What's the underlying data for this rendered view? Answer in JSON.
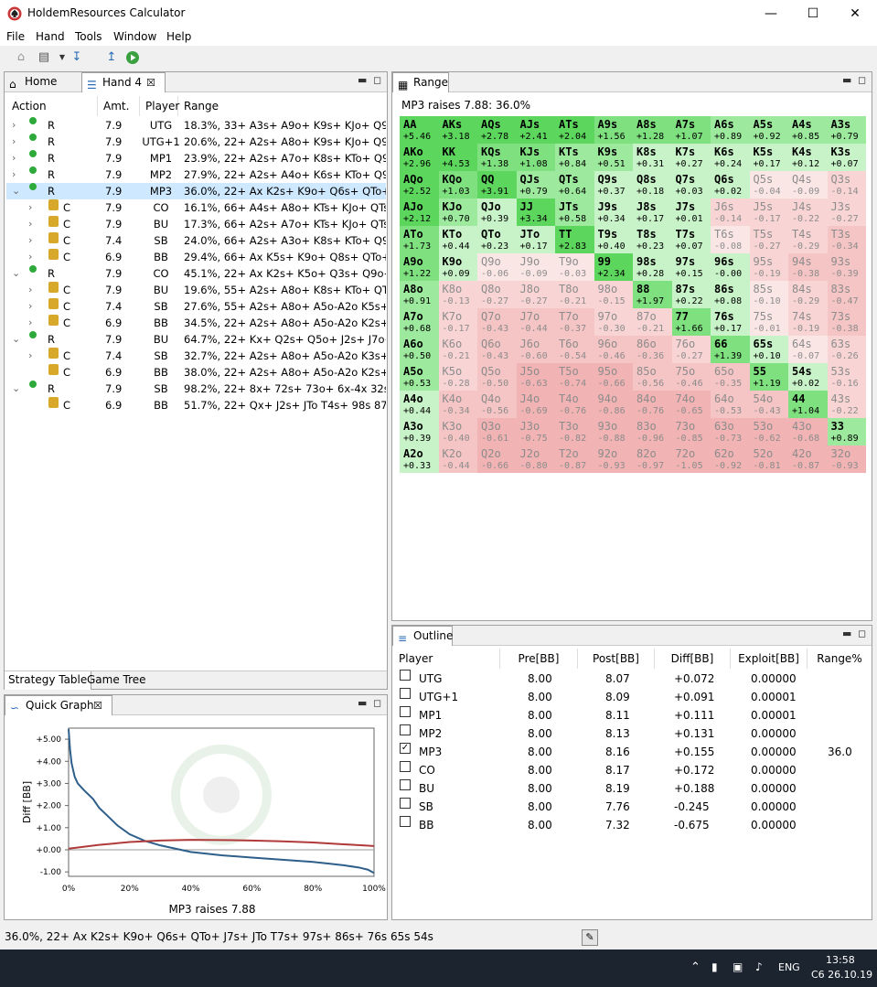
{
  "window": {
    "title": "HoldemResources Calculator"
  },
  "menu": [
    "File",
    "Hand",
    "Tools",
    "Window",
    "Help"
  ],
  "tabs": {
    "home": "Home",
    "hand": "Hand 4",
    "range": "Range",
    "outline": "Outline",
    "quick_graph": "Quick Graph",
    "strategy_table": "Strategy Table",
    "game_tree": "Game Tree"
  },
  "strategy": {
    "headers": [
      "Action",
      "Amt.",
      "Player",
      "Range"
    ],
    "rows": [
      {
        "action": "R",
        "amt": "7.9",
        "player": "UTG",
        "range": "18.3%, 33+ A3s+ A9o+ K9s+ KJo+ Q9s+ J9",
        "indent": 0,
        "open": false,
        "lock": false
      },
      {
        "action": "R",
        "amt": "7.9",
        "player": "UTG+1",
        "range": "20.6%, 22+ A2s+ A8o+ K9s+ KJo+ Q9s+ J9",
        "indent": 0,
        "open": false,
        "lock": false
      },
      {
        "action": "R",
        "amt": "7.9",
        "player": "MP1",
        "range": "23.9%, 22+ A2s+ A7o+ K8s+ KTo+ Q9s+ Q",
        "indent": 0,
        "open": false,
        "lock": false
      },
      {
        "action": "R",
        "amt": "7.9",
        "player": "MP2",
        "range": "27.9%, 22+ A2s+ A4o+ K6s+ KTo+ Q9s+ Q",
        "indent": 0,
        "open": false,
        "lock": false
      },
      {
        "action": "R",
        "amt": "7.9",
        "player": "MP3",
        "range": "36.0%, 22+ Ax K2s+ K9o+ Q6s+ QTo+ J7s+",
        "indent": 0,
        "open": true,
        "lock": false,
        "sel": true
      },
      {
        "action": "C",
        "amt": "7.9",
        "player": "CO",
        "range": "16.1%, 66+ A4s+ A8o+ KTs+ KJo+ QTs+ JT",
        "indent": 1,
        "open": false,
        "lock": true
      },
      {
        "action": "C",
        "amt": "7.9",
        "player": "BU",
        "range": "17.3%, 66+ A2s+ A7o+ KTs+ KJo+ QTs+",
        "indent": 1,
        "open": false,
        "lock": true
      },
      {
        "action": "C",
        "amt": "7.4",
        "player": "SB",
        "range": "24.0%, 66+ A2s+ A3o+ K8s+ KTo+ Q9s+ Q",
        "indent": 1,
        "open": false,
        "lock": true
      },
      {
        "action": "C",
        "amt": "6.9",
        "player": "BB",
        "range": "29.4%, 66+ Ax K5s+ K9o+ Q8s+ QTo+ J9s+",
        "indent": 1,
        "open": false,
        "lock": true
      },
      {
        "action": "R",
        "amt": "7.9",
        "player": "CO",
        "range": "45.1%, 22+ Ax K2s+ K5o+ Q3s+ Q9o+ J6s+",
        "indent": 0,
        "open": true,
        "lock": false
      },
      {
        "action": "C",
        "amt": "7.9",
        "player": "BU",
        "range": "19.6%, 55+ A2s+ A8o+ K8s+ KTo+ QTs+ Q",
        "indent": 1,
        "open": false,
        "lock": true
      },
      {
        "action": "C",
        "amt": "7.4",
        "player": "SB",
        "range": "27.6%, 55+ A2s+ A8o+ A5o-A2o K5s+ K9o",
        "indent": 1,
        "open": false,
        "lock": true
      },
      {
        "action": "C",
        "amt": "6.9",
        "player": "BB",
        "range": "34.5%, 22+ A2s+ A8o+ A5o-A2o K2s+ K8o",
        "indent": 1,
        "open": false,
        "lock": true
      },
      {
        "action": "R",
        "amt": "7.9",
        "player": "BU",
        "range": "64.7%, 22+ Kx+ Q2s+ Q5o+ J2s+ J7o+ T3s-",
        "indent": 0,
        "open": true,
        "lock": false
      },
      {
        "action": "C",
        "amt": "7.4",
        "player": "SB",
        "range": "32.7%, 22+ A2s+ A8o+ A5o-A2o K3s+ K8o",
        "indent": 1,
        "open": false,
        "lock": true
      },
      {
        "action": "C",
        "amt": "6.9",
        "player": "BB",
        "range": "38.0%, 22+ A2s+ A8o+ A5o-A2o K2s+ K8o",
        "indent": 1,
        "open": false,
        "lock": true,
        "noarrow": true
      },
      {
        "action": "R",
        "amt": "7.9",
        "player": "SB",
        "range": "98.2%, 22+ 8x+ 72s+ 73o+ 6x-4x 32s",
        "indent": 0,
        "open": true,
        "lock": false
      },
      {
        "action": "C",
        "amt": "6.9",
        "player": "BB",
        "range": "51.7%, 22+ Qx+ J2s+ JTo T4s+ 98s 87s",
        "indent": 1,
        "open": false,
        "lock": true,
        "noarrow": true
      }
    ]
  },
  "range_panel": {
    "caption": "MP3 raises 7.88: 36.0%",
    "hands": [
      [
        "AA",
        "AKs",
        "AQs",
        "AJs",
        "ATs",
        "A9s",
        "A8s",
        "A7s",
        "A6s",
        "A5s",
        "A4s",
        "A3s"
      ],
      [
        "AKo",
        "KK",
        "KQs",
        "KJs",
        "KTs",
        "K9s",
        "K8s",
        "K7s",
        "K6s",
        "K5s",
        "K4s",
        "K3s"
      ],
      [
        "AQo",
        "KQo",
        "QQ",
        "QJs",
        "QTs",
        "Q9s",
        "Q8s",
        "Q7s",
        "Q6s",
        "Q5s",
        "Q4s",
        "Q3s"
      ],
      [
        "AJo",
        "KJo",
        "QJo",
        "JJ",
        "JTs",
        "J9s",
        "J8s",
        "J7s",
        "J6s",
        "J5s",
        "J4s",
        "J3s"
      ],
      [
        "ATo",
        "KTo",
        "QTo",
        "JTo",
        "TT",
        "T9s",
        "T8s",
        "T7s",
        "T6s",
        "T5s",
        "T4s",
        "T3s"
      ],
      [
        "A9o",
        "K9o",
        "Q9o",
        "J9o",
        "T9o",
        "99",
        "98s",
        "97s",
        "96s",
        "95s",
        "94s",
        "93s"
      ],
      [
        "A8o",
        "K8o",
        "Q8o",
        "J8o",
        "T8o",
        "98o",
        "88",
        "87s",
        "86s",
        "85s",
        "84s",
        "83s"
      ],
      [
        "A7o",
        "K7o",
        "Q7o",
        "J7o",
        "T7o",
        "97o",
        "87o",
        "77",
        "76s",
        "75s",
        "74s",
        "73s"
      ],
      [
        "A6o",
        "K6o",
        "Q6o",
        "J6o",
        "T6o",
        "96o",
        "86o",
        "76o",
        "66",
        "65s",
        "64s",
        "63s"
      ],
      [
        "A5o",
        "K5o",
        "Q5o",
        "J5o",
        "T5o",
        "95o",
        "85o",
        "75o",
        "65o",
        "55",
        "54s",
        "53s"
      ],
      [
        "A4o",
        "K4o",
        "Q4o",
        "J4o",
        "T4o",
        "94o",
        "84o",
        "74o",
        "64o",
        "54o",
        "44",
        "43s"
      ],
      [
        "A3o",
        "K3o",
        "Q3o",
        "J3o",
        "T3o",
        "93o",
        "83o",
        "73o",
        "63o",
        "53o",
        "43o",
        "33"
      ],
      [
        "A2o",
        "K2o",
        "Q2o",
        "J2o",
        "T2o",
        "92o",
        "82o",
        "72o",
        "62o",
        "52o",
        "42o",
        "32o"
      ]
    ],
    "values": [
      [
        "+5.46",
        "+3.18",
        "+2.78",
        "+2.41",
        "+2.04",
        "+1.56",
        "+1.28",
        "+1.07",
        "+0.89",
        "+0.92",
        "+0.85",
        "+0.79"
      ],
      [
        "+2.96",
        "+4.53",
        "+1.38",
        "+1.08",
        "+0.84",
        "+0.51",
        "+0.31",
        "+0.27",
        "+0.24",
        "+0.17",
        "+0.12",
        "+0.07"
      ],
      [
        "+2.52",
        "+1.03",
        "+3.91",
        "+0.79",
        "+0.64",
        "+0.37",
        "+0.18",
        "+0.03",
        "+0.02",
        "-0.04",
        "-0.09",
        "-0.14"
      ],
      [
        "+2.12",
        "+0.70",
        "+0.39",
        "+3.34",
        "+0.58",
        "+0.34",
        "+0.17",
        "+0.01",
        "-0.14",
        "-0.17",
        "-0.22",
        "-0.27"
      ],
      [
        "+1.73",
        "+0.44",
        "+0.23",
        "+0.17",
        "+2.83",
        "+0.40",
        "+0.23",
        "+0.07",
        "-0.08",
        "-0.27",
        "-0.29",
        "-0.34"
      ],
      [
        "+1.22",
        "+0.09",
        "-0.06",
        "-0.09",
        "-0.03",
        "+2.34",
        "+0.28",
        "+0.15",
        "-0.00",
        "-0.19",
        "-0.38",
        "-0.39"
      ],
      [
        "+0.91",
        "-0.13",
        "-0.27",
        "-0.27",
        "-0.21",
        "-0.15",
        "+1.97",
        "+0.22",
        "+0.08",
        "-0.10",
        "-0.29",
        "-0.47"
      ],
      [
        "+0.68",
        "-0.17",
        "-0.43",
        "-0.44",
        "-0.37",
        "-0.30",
        "-0.21",
        "+1.66",
        "+0.17",
        "-0.01",
        "-0.19",
        "-0.38"
      ],
      [
        "+0.50",
        "-0.21",
        "-0.43",
        "-0.60",
        "-0.54",
        "-0.46",
        "-0.36",
        "-0.27",
        "+1.39",
        "+0.10",
        "-0.07",
        "-0.26"
      ],
      [
        "+0.53",
        "-0.28",
        "-0.50",
        "-0.63",
        "-0.74",
        "-0.66",
        "-0.56",
        "-0.46",
        "-0.35",
        "+1.19",
        "+0.02",
        "-0.16"
      ],
      [
        "+0.44",
        "-0.34",
        "-0.56",
        "-0.69",
        "-0.76",
        "-0.86",
        "-0.76",
        "-0.65",
        "-0.53",
        "-0.43",
        "+1.04",
        "-0.22"
      ],
      [
        "+0.39",
        "-0.40",
        "-0.61",
        "-0.75",
        "-0.82",
        "-0.88",
        "-0.96",
        "-0.85",
        "-0.73",
        "-0.62",
        "-0.68",
        "+0.89"
      ],
      [
        "+0.33",
        "-0.44",
        "-0.66",
        "-0.80",
        "-0.87",
        "-0.93",
        "-0.97",
        "-1.05",
        "-0.92",
        "-0.81",
        "-0.87",
        "-0.93"
      ]
    ]
  },
  "outline": {
    "headers": [
      "Player",
      "Pre[BB]",
      "Post[BB]",
      "Diff[BB]",
      "Exploit[BB]",
      "Range%"
    ],
    "rows": [
      {
        "player": "UTG",
        "pre": "8.00",
        "post": "8.07",
        "diff": "+0.072",
        "exploit": "0.00000",
        "range": "",
        "checked": false
      },
      {
        "player": "UTG+1",
        "pre": "8.00",
        "post": "8.09",
        "diff": "+0.091",
        "exploit": "0.00001",
        "range": "",
        "checked": false
      },
      {
        "player": "MP1",
        "pre": "8.00",
        "post": "8.11",
        "diff": "+0.111",
        "exploit": "0.00001",
        "range": "",
        "checked": false
      },
      {
        "player": "MP2",
        "pre": "8.00",
        "post": "8.13",
        "diff": "+0.131",
        "exploit": "0.00000",
        "range": "",
        "checked": false
      },
      {
        "player": "MP3",
        "pre": "8.00",
        "post": "8.16",
        "diff": "+0.155",
        "exploit": "0.00000",
        "range": "36.0",
        "checked": true
      },
      {
        "player": "CO",
        "pre": "8.00",
        "post": "8.17",
        "diff": "+0.172",
        "exploit": "0.00000",
        "range": "",
        "checked": false
      },
      {
        "player": "BU",
        "pre": "8.00",
        "post": "8.19",
        "diff": "+0.188",
        "exploit": "0.00000",
        "range": "",
        "checked": false
      },
      {
        "player": "SB",
        "pre": "8.00",
        "post": "7.76",
        "diff": "-0.245",
        "exploit": "0.00000",
        "range": "",
        "checked": false
      },
      {
        "player": "BB",
        "pre": "8.00",
        "post": "7.32",
        "diff": "-0.675",
        "exploit": "0.00000",
        "range": "",
        "checked": false
      }
    ]
  },
  "chart_data": {
    "type": "line",
    "xlabel": "MP3 raises 7.88",
    "ylabel": "Diff [BB]",
    "x_ticks": [
      "0%",
      "20%",
      "40%",
      "60%",
      "80%",
      "100%"
    ],
    "y_ticks": [
      "+5.00",
      "+4.00",
      "+3.00",
      "+2.00",
      "+1.00",
      "+0.00",
      "-1.00"
    ],
    "xlim": [
      0,
      100
    ],
    "ylim": [
      -1.2,
      5.5
    ],
    "series": [
      {
        "color": "#2e5f8a",
        "x": [
          0,
          0.5,
          1,
          2,
          3,
          5,
          8,
          10,
          13,
          16,
          20,
          25,
          30,
          35,
          40,
          50,
          60,
          70,
          80,
          90,
          95,
          98,
          100
        ],
        "y": [
          5.46,
          4.5,
          3.9,
          3.3,
          3.0,
          2.7,
          2.3,
          1.9,
          1.5,
          1.1,
          0.7,
          0.4,
          0.2,
          0.05,
          -0.1,
          -0.25,
          -0.35,
          -0.45,
          -0.55,
          -0.7,
          -0.8,
          -0.9,
          -1.05
        ]
      },
      {
        "color": "#b03a3a",
        "x": [
          0,
          10,
          20,
          30,
          40,
          50,
          60,
          70,
          80,
          90,
          100
        ],
        "y": [
          0.05,
          0.22,
          0.35,
          0.42,
          0.45,
          0.44,
          0.42,
          0.38,
          0.33,
          0.25,
          0.17
        ]
      }
    ]
  },
  "status": {
    "text": "36.0%, 22+ Ax K2s+ K9o+ Q6s+ QTo+ J7s+ JTo T7s+ 97s+ 86s+ 76s 65s 54s"
  },
  "taskbar": {
    "lang": "ENG",
    "time": "13:58",
    "date": "C6 26.10.19"
  }
}
